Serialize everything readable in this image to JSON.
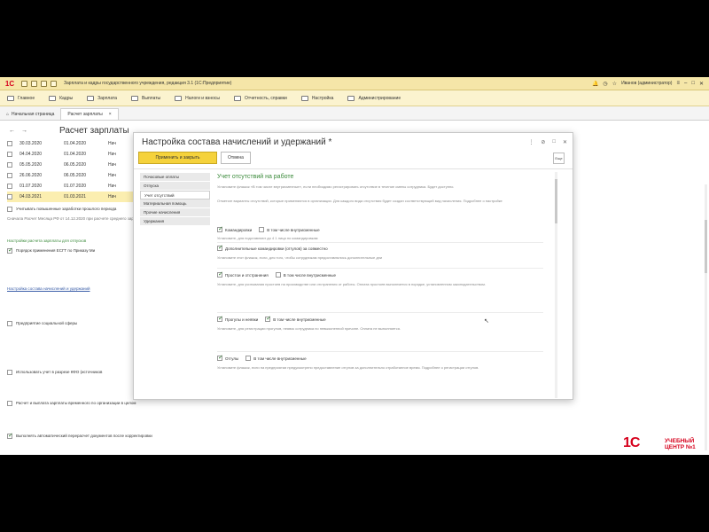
{
  "titlebar": {
    "logo": "1С",
    "title": "Зарплата и кадры государственного учреждения, редакция 3.1 (1С:Предприятие)",
    "user": "Иванов (администратор)"
  },
  "menu": [
    "Главное",
    "Кадры",
    "Зарплата",
    "Выплаты",
    "Налоги и взносы",
    "Отчетность, справки",
    "Настройка",
    "Администрирование"
  ],
  "tabs": {
    "home": "Начальная страница",
    "active": "Расчет зарплаты"
  },
  "bgform": {
    "title": "Расчет зарплаты",
    "rows": [
      {
        "a": "30.03.2020",
        "b": "01.04.2020",
        "c": "Нач"
      },
      {
        "a": "04.04.2020",
        "b": "01.04.2020",
        "c": "Нач"
      },
      {
        "a": "05.05.2020",
        "b": "06.05.2020",
        "c": "Нач"
      },
      {
        "a": "26.06.2020",
        "b": "06.05.2020",
        "c": "Нач"
      },
      {
        "a": "01.07.2020",
        "b": "01.07.2020",
        "c": "Нач"
      },
      {
        "a": "04.03.2021",
        "b": "01.03.2021",
        "c": "Нач"
      }
    ],
    "t1": "Учитывать повышенные заработки прошлого периода",
    "t2": "Сначала Расчет Месяца РФ от 14.12.2020 при расчете среднего заработка. Отсчеты",
    "t3": "Настройки расчета зарплаты для отпусков",
    "t4": "Порядок применения ЕСГТ по Приказу Ми",
    "t5": "Настройка состава начислений и удержаний",
    "t6": "Предприятие социальной сферы",
    "t7": "Использовать учет в разрезе КФО (источников",
    "t8": "Расчет и выплата зарплаты временного по организации в целом",
    "t9": "Выполнять автоматический перерасчет документов после корректировки"
  },
  "dialog": {
    "title": "Настройка состава начислений и удержаний *",
    "save_btn": "Применить и закрыть",
    "cancel_btn": "Отмена",
    "more": "Еще",
    "left_items": [
      "Почасовые оплаты",
      "Отпуска",
      "Учет отсутствий",
      "Материальная помощь",
      "Прочие начисления",
      "Удержания"
    ],
    "section_title": "Учет отсутствий на работе",
    "p1": "Установите флажок «В том числе внутрисменные», если необходимо регистрировать отсутствие в течение смены сотрудника. Будет доступно.",
    "p2": "Отметьте варианты отсутствий, которые применяются в организации. Для каждого вида отсутствия будет создан соответствующий вид начисления. Подробнее о настройке",
    "chk1": "Командировки",
    "chk1b": "В том числе внутрисменные",
    "n1": "Установите, для подставляют до 4 1 лица по командировкам",
    "chk2": "Дополнительные командировки (отгулов) за совместно",
    "n2": "Установите этот флажок, если, для того, чтобы сотрудникам предоставлялись дополнительные дни",
    "chk3": "Простои и отстранения",
    "chk3b": "В том числе внутрисменные",
    "n3": "Установите, для учитывания простоев на производстве или отстранения от работы. Оплата простоев выполняется в порядке, установленном законодательством.",
    "chk4": "Прогулы и неявки",
    "chk4b": "В том числе внутрисменные",
    "n4": "Установите, для регистрации прогулов, неявок сотрудника по невыясненной причине. Оплата не выполняется.",
    "chk5": "Отгулы",
    "chk5b": "В том числе внутрисменные",
    "n5": "Установите флажок, если на предприятии предусмотрено предоставление отгулов за дополнительно отработанное время. Подробнее о регистрации отгулов."
  },
  "brand": {
    "logo": "1С",
    "line1": "УЧЕБНЫЙ",
    "line2": "ЦЕНТР №1"
  }
}
